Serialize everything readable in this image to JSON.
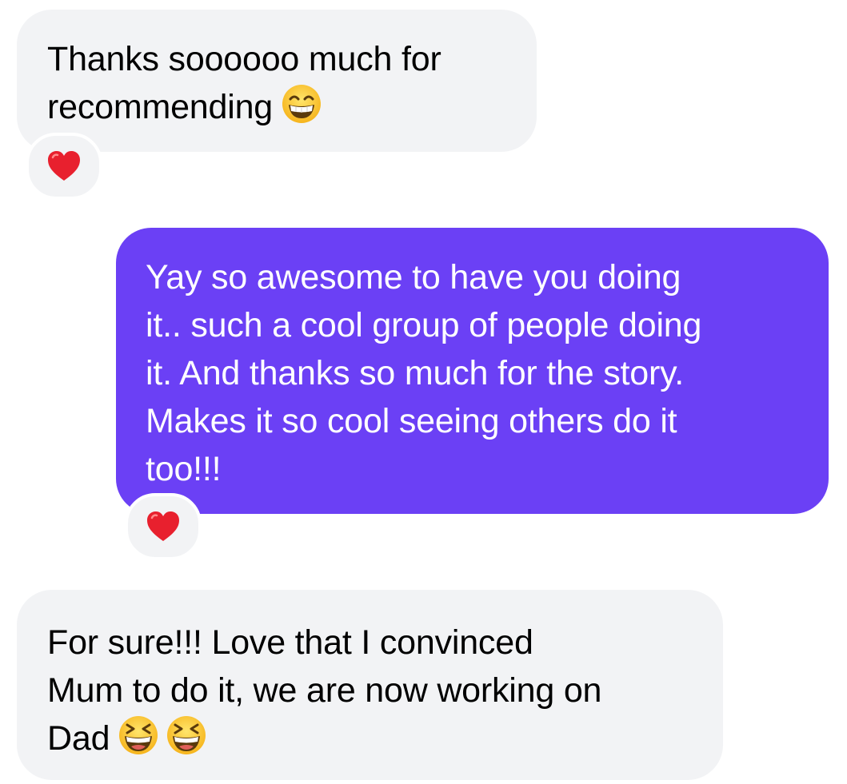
{
  "colors": {
    "incoming_bubble": "#f2f3f5",
    "outgoing_bubble": "#6b40f5",
    "incoming_text": "#000000",
    "outgoing_text": "#ffffff",
    "reaction_heart": "#e8202e"
  },
  "messages": [
    {
      "direction": "incoming",
      "lines": [
        "Thanks soooooo much for",
        "recommending"
      ],
      "trailing_emojis": [
        "grinning-face-with-smiling-eyes"
      ],
      "reaction": "red-heart"
    },
    {
      "direction": "outgoing",
      "lines": [
        "Yay so awesome to have you doing",
        "it.. such a cool group of people doing",
        "it. And thanks so much for the story.",
        "Makes it so cool seeing others do it",
        "too!!!"
      ],
      "trailing_emojis": [],
      "reaction": "red-heart"
    },
    {
      "direction": "incoming",
      "lines": [
        "For sure!!! Love that I convinced",
        "Mum to do it, we are now working on",
        "Dad"
      ],
      "trailing_emojis": [
        "grinning-squinting-face",
        "grinning-squinting-face"
      ],
      "reaction": null
    }
  ]
}
